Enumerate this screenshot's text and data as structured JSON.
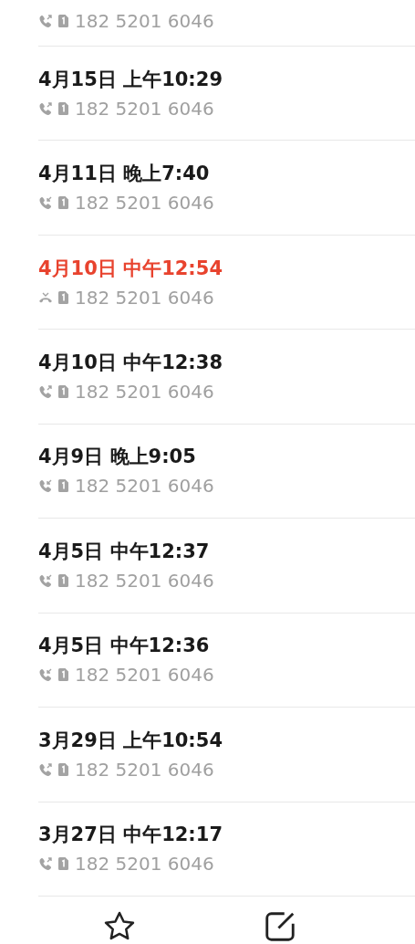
{
  "calls": [
    {
      "kind": "outgoing",
      "number": "182 5201 6046"
    },
    {
      "title": "4月15日 上午10:29",
      "kind": "outgoing",
      "number": "182 5201 6046"
    },
    {
      "title": "4月11日 晚上7:40",
      "kind": "incoming",
      "number": "182 5201 6046"
    },
    {
      "title": "4月10日 中午12:54",
      "kind": "missed",
      "number": "182 5201 6046"
    },
    {
      "title": "4月10日 中午12:38",
      "kind": "outgoing",
      "number": "182 5201 6046"
    },
    {
      "title": "4月9日 晚上9:05",
      "kind": "incoming",
      "number": "182 5201 6046"
    },
    {
      "title": "4月5日 中午12:37",
      "kind": "incoming",
      "number": "182 5201 6046"
    },
    {
      "title": "4月5日 中午12:36",
      "kind": "incoming",
      "number": "182 5201 6046"
    },
    {
      "title": "3月29日 上午10:54",
      "kind": "outgoing",
      "number": "182 5201 6046"
    },
    {
      "title": "3月27日 中午12:17",
      "kind": "outgoing",
      "number": "182 5201 6046"
    }
  ]
}
